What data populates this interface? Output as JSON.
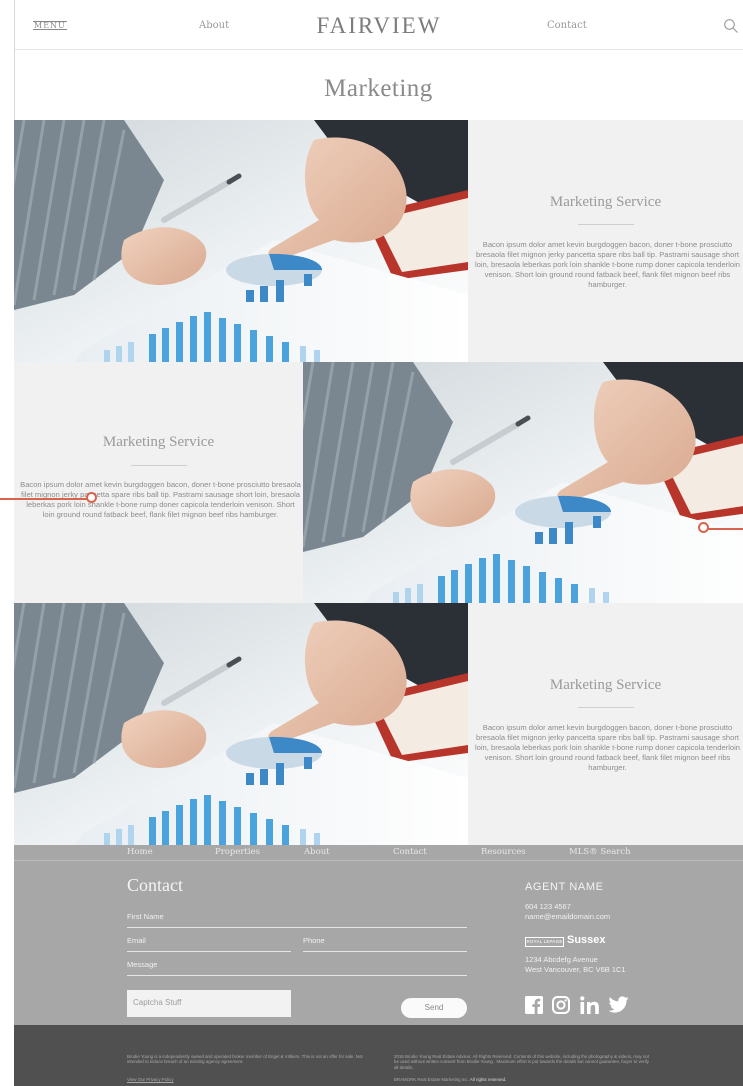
{
  "header": {
    "menu_label": "MENU",
    "about_label": "About",
    "brand": "FAIRVIEW",
    "contact_label": "Contact",
    "search_icon": "search-icon"
  },
  "page_title": "Marketing",
  "services": [
    {
      "title": "Marketing Service",
      "body": "Bacon ipsum dolor amet kevin burgdoggen bacon, doner t-bone prosciutto bresaola filet mignon jerky pancetta spare ribs ball tip. Pastrami sausage short loin, bresaola leberkas pork loin shankle t-bone rump doner capicola tenderloin venison. Short loin ground round fatback beef, flank filet mignon beef ribs hamburger."
    },
    {
      "title": "Marketing Service",
      "body": "Bacon ipsum dolor amet kevin burgdoggen bacon, doner t-bone prosciutto bresaola filet mignon jerky pancetta spare ribs ball tip. Pastrami sausage short loin, bresaola leberkas pork loin shankle t-bone rump doner capicola tenderloin venison. Short loin ground round fatback beef, flank filet mignon beef ribs hamburger."
    },
    {
      "title": "Marketing Service",
      "body": "Bacon ipsum dolor amet kevin burgdoggen bacon, doner t-bone prosciutto bresaola filet mignon jerky pancetta spare ribs ball tip. Pastrami sausage short loin, bresaola leberkas pork loin shankle t-bone rump doner capicola tenderloin venison. Short loin ground round fatback beef, flank filet mignon beef ribs hamburger."
    }
  ],
  "footer_nav": [
    "Home",
    "Properties",
    "About",
    "Contact",
    "Resources",
    "MLS® Search"
  ],
  "contact_form": {
    "title": "Contact",
    "first_name_label": "First Name",
    "email_label": "Email",
    "phone_label": "Phone",
    "message_label": "Message",
    "captcha_label": "Captcha Stuff",
    "send_label": "Send"
  },
  "agent": {
    "name": "AGENT NAME",
    "phone": "604 123 4567",
    "email": "name@emaildomain.com",
    "brokerage_badge": "ROYAL LEPAGE",
    "brokerage": "Sussex",
    "address_line1": "1234 Abcdefg Avenue",
    "address_line2": "West Vancouver, BC  V6B 1C1"
  },
  "social_icons": [
    "facebook-icon",
    "instagram-icon",
    "linkedin-icon",
    "twitter-icon"
  ],
  "legal": {
    "left": "Brodie Young is a independently owned and operated broker member of Engel & Völkers. This is not an offer for sale. Not intended to induce breach of an existing agency agreement.",
    "privacy_link": "View Our Privacy Policy",
    "right": "2016 Brodie Young Real Estate Advisor. All Rights Reserved. Contents of this website, including the photography & videos, may not be used without written consent from Brodie Young . Maximum effort is put towards the details but cannot guarantee, buyer to verify all details.",
    "credit_prefix": "BRAMORK Real Estate Marketing Inc.",
    "credit_suffix": "All rights reserved."
  },
  "colors": {
    "accent_annotation": "#d9644d",
    "footer_bg": "#a7a7a7",
    "bottom_bar_bg": "#505050",
    "text_panel_bg": "#f1f1f1"
  }
}
